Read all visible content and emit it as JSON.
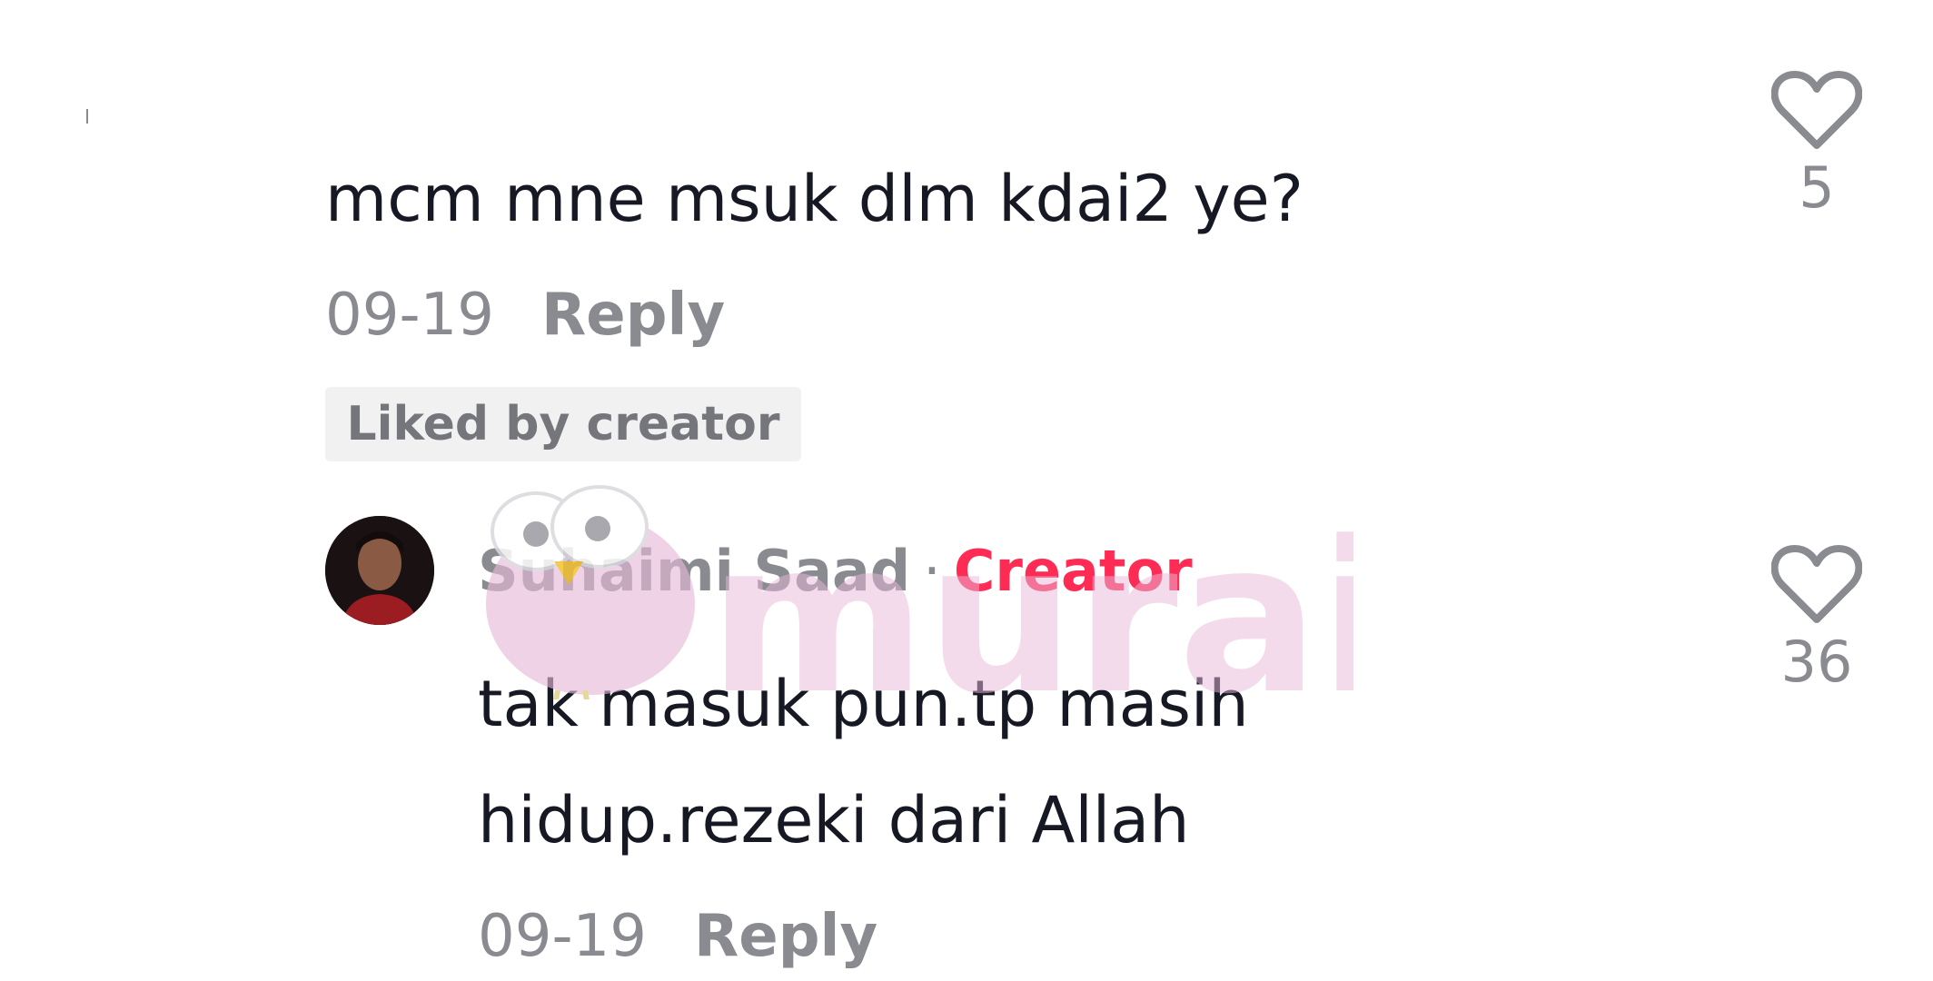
{
  "comment1": {
    "text": "mcm mne msuk dlm kdai2 ye?",
    "date": "09-19",
    "reply_label": "Reply",
    "liked_badge": "Liked by creator",
    "like_count": "5"
  },
  "reply1": {
    "author": "Suhaimi Saad",
    "separator": "·",
    "role": "Creator",
    "text_line1": "tak masuk pun.tp masih",
    "text_line2": "hidup.rezeki dari Allah",
    "date": "09-19",
    "reply_label": "Reply",
    "like_count": "36"
  },
  "watermark": {
    "text": "murai"
  },
  "colors": {
    "text_primary": "#161823",
    "text_secondary": "#8a8b91",
    "creator_accent": "#fe2c55",
    "badge_bg": "#f1f1f2",
    "watermark_pink": "#e6b8d8"
  },
  "icons": {
    "like": "heart-outline-icon",
    "avatar": "user-avatar",
    "watermark_bird": "bird-mascot-icon"
  }
}
